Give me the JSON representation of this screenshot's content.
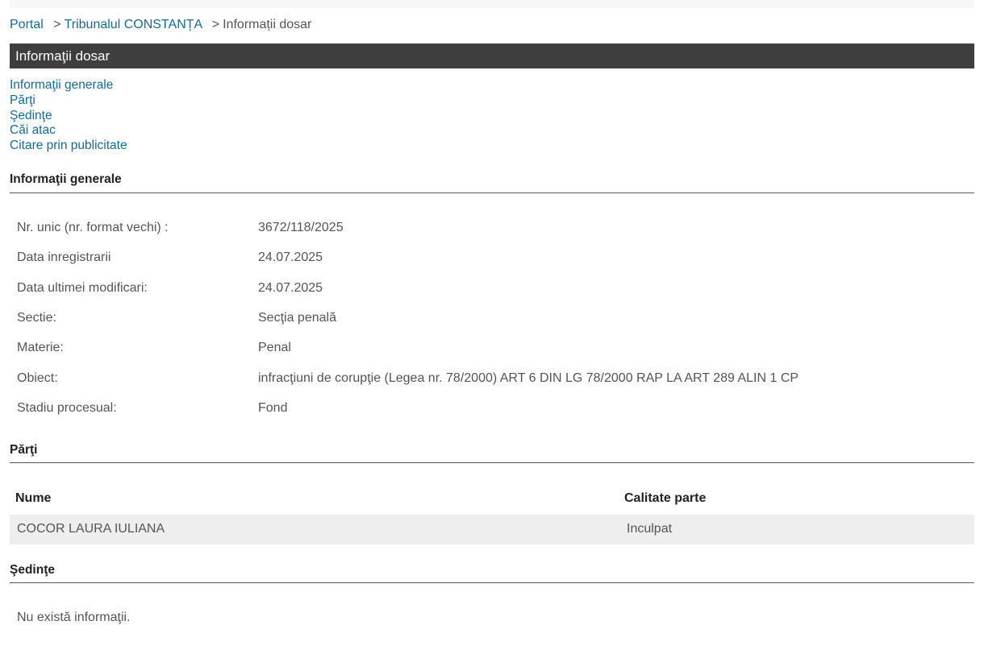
{
  "breadcrumb": {
    "items": [
      "Portal",
      "Tribunalul CONSTANȚA",
      "Informații dosar"
    ],
    "separator": ">"
  },
  "title_bar": "Informaţii dosar",
  "nav": {
    "links": [
      "Informaţii generale",
      "Părţi",
      "Şedinţe",
      "Căi atac",
      "Citare prin publicitate"
    ]
  },
  "general": {
    "heading": "Informaţii generale",
    "rows": [
      {
        "label": "Nr. unic (nr. format vechi) :",
        "value": "3672/118/2025"
      },
      {
        "label": "Data inregistrarii",
        "value": "24.07.2025"
      },
      {
        "label": "Data ultimei modificari:",
        "value": "24.07.2025"
      },
      {
        "label": "Sectie:",
        "value": "Secţia penală"
      },
      {
        "label": "Materie:",
        "value": "Penal"
      },
      {
        "label": "Obiect:",
        "value": "infracţiuni de corupţie (Legea nr. 78/2000) ART 6 DIN LG 78/2000 RAP LA ART 289 ALIN 1 CP"
      },
      {
        "label": "Stadiu procesual:",
        "value": "Fond"
      }
    ]
  },
  "parties": {
    "heading": "Părţi",
    "columns": [
      "Nume",
      "Calitate parte"
    ],
    "rows": [
      {
        "name": "COCOR LAURA IULIANA",
        "role": "Inculpat"
      }
    ]
  },
  "hearings": {
    "heading": "Şedinţe",
    "empty_text": "Nu există informaţii."
  },
  "colors": {
    "link": "#1a6a8c",
    "title_bar_bg": "#3e3e3e",
    "row_bg": "#eeeeee"
  }
}
